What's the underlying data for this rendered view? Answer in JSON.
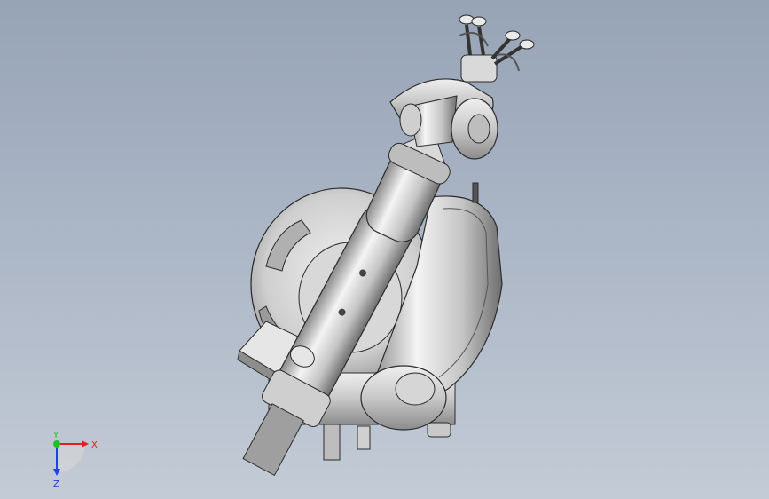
{
  "viewport": {
    "background_top": "#97a4b6",
    "background_bottom": "#c3cbd6"
  },
  "model": {
    "shade_light": "#f2f2f2",
    "shade_mid": "#c9c9c9",
    "shade_dark": "#7d7d7d",
    "edge": "#2b2b2b"
  },
  "triad": {
    "x_label": "X",
    "y_label": "Y",
    "z_label": "Z",
    "x_color": "#e02020",
    "y_color": "#20c020",
    "z_color": "#2040e0"
  }
}
